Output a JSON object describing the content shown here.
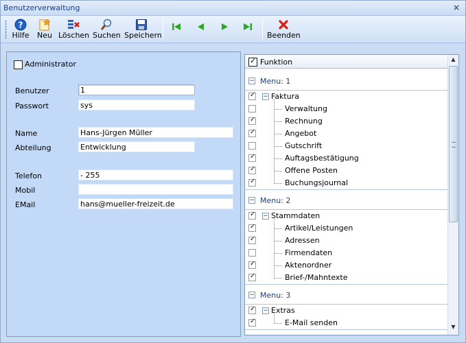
{
  "window": {
    "title": "Benutzerverwaltung",
    "close_glyph": "×"
  },
  "toolbar": {
    "buttons": [
      {
        "label": "Hilfe",
        "icon": "help-icon"
      },
      {
        "label": "Neu",
        "icon": "new-icon"
      },
      {
        "label": "Löschen",
        "icon": "delete-icon"
      },
      {
        "label": "Suchen",
        "icon": "search-icon"
      },
      {
        "label": "Speichern",
        "icon": "save-icon"
      },
      {
        "label": "Beenden",
        "icon": "close-icon"
      }
    ],
    "nav_icons": [
      "first-record-icon",
      "previous-record-icon",
      "next-record-icon",
      "last-record-icon"
    ],
    "colors": {
      "nav_green": "#2ea822",
      "close_red": "#d81b10",
      "help_blue": "#1f63c6"
    }
  },
  "form": {
    "administrator_label": "Administrator",
    "administrator_checked": false,
    "benutzer_label": "Benutzer",
    "benutzer_value": "1",
    "passwort_label": "Passwort",
    "passwort_value": "sys",
    "name_label": "Name",
    "name_value": "Hans-Jürgen Müller",
    "abteilung_label": "Abteilung",
    "abteilung_value": "Entwicklung",
    "telefon_label": "Telefon",
    "telefon_value": "- 255",
    "mobil_label": "Mobil",
    "mobil_value": "",
    "email_label": "EMail",
    "email_value": "hans@mueller-freizeit.de"
  },
  "functions": {
    "header_label": "Funktion",
    "header_checked": true,
    "groups": [
      {
        "label": "Menu: 1",
        "parent": {
          "label": "Faktura",
          "checked": true
        },
        "items": [
          {
            "label": "Verwaltung",
            "checked": false
          },
          {
            "label": "Rechnung",
            "checked": true
          },
          {
            "label": "Angebot",
            "checked": true
          },
          {
            "label": "Gutschrift",
            "checked": false
          },
          {
            "label": "Auftagsbestätigung",
            "checked": true
          },
          {
            "label": "Offene Posten",
            "checked": true
          },
          {
            "label": "Buchungsjournal",
            "checked": true
          }
        ]
      },
      {
        "label": "Menu: 2",
        "parent": {
          "label": "Stammdaten",
          "checked": true
        },
        "items": [
          {
            "label": "Artikel/Leistungen",
            "checked": true
          },
          {
            "label": "Adressen",
            "checked": true
          },
          {
            "label": "Firmendaten",
            "checked": false
          },
          {
            "label": "Aktenordner",
            "checked": true
          },
          {
            "label": "Brief-/Mahntexte",
            "checked": true
          }
        ]
      },
      {
        "label": "Menu: 3",
        "parent": {
          "label": "Extras",
          "checked": true
        },
        "items": [
          {
            "label": "E-Mail senden",
            "checked": true
          }
        ]
      }
    ],
    "expand_glyph": "−"
  },
  "scrollbar": {
    "up_glyph": "▲",
    "down_glyph": "▼"
  }
}
